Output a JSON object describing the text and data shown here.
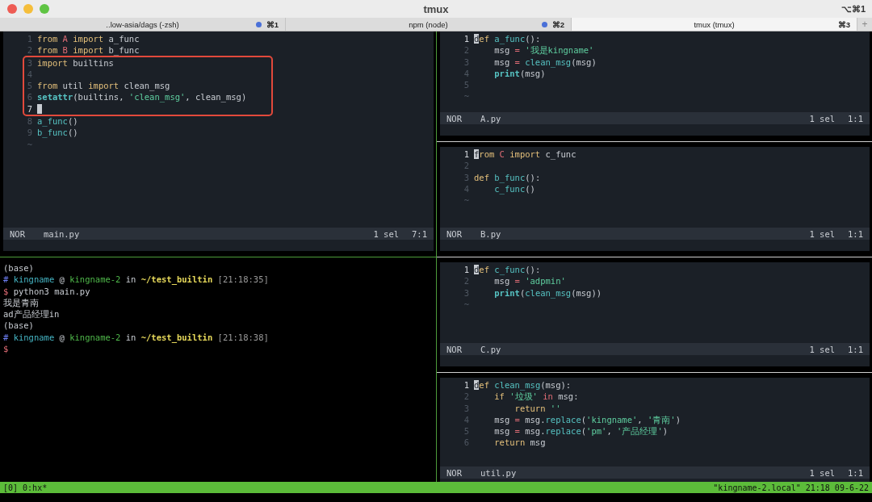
{
  "window": {
    "title": "tmux",
    "shortcut": "⌥⌘1"
  },
  "tabs": [
    {
      "label": "..low-asia/dags (-zsh)",
      "shortcut": "⌘1",
      "activity": true,
      "selected": false
    },
    {
      "label": "npm (node)",
      "shortcut": "⌘2",
      "activity": true,
      "selected": false
    },
    {
      "label": "tmux (tmux)",
      "shortcut": "⌘3",
      "activity": false,
      "selected": true
    }
  ],
  "new_tab": "+",
  "left_editor": {
    "lines": [
      {
        "number": "1",
        "cursor": false,
        "boxed": false,
        "tokens": [
          {
            "text": "from",
            "kind": "kw"
          },
          {
            "text": " A ",
            "kind": "mod"
          },
          {
            "text": "import",
            "kind": "kw"
          },
          {
            "text": " a_func",
            "kind": "plain"
          }
        ]
      },
      {
        "number": "2",
        "cursor": false,
        "boxed": false,
        "tokens": [
          {
            "text": "from",
            "kind": "kw"
          },
          {
            "text": " B ",
            "kind": "mod"
          },
          {
            "text": "import",
            "kind": "kw"
          },
          {
            "text": " b_func",
            "kind": "plain"
          }
        ]
      },
      {
        "number": "3",
        "cursor": false,
        "boxed": true,
        "tokens": [
          {
            "text": "import",
            "kind": "kw"
          },
          {
            "text": " builtins",
            "kind": "plain"
          }
        ]
      },
      {
        "number": "4",
        "cursor": false,
        "boxed": true
      },
      {
        "number": "5",
        "cursor": false,
        "boxed": true,
        "tokens": [
          {
            "text": "from",
            "kind": "kw"
          },
          {
            "text": " util ",
            "kind": "plain"
          },
          {
            "text": "import",
            "kind": "kw"
          },
          {
            "text": " clean_msg",
            "kind": "plain"
          }
        ]
      },
      {
        "number": "6",
        "cursor": false,
        "boxed": true,
        "tokens": [
          {
            "text": "setattr",
            "kind": "builtin"
          },
          {
            "text": "(builtins, ",
            "kind": "plain"
          },
          {
            "text": "'clean_msg'",
            "kind": "str"
          },
          {
            "text": ", clean_msg)",
            "kind": "plain"
          }
        ]
      },
      {
        "number": "7",
        "cursor": true,
        "boxed": true
      },
      {
        "number": "8",
        "cursor": false,
        "boxed": false,
        "tokens": [
          {
            "text": "a_func",
            "kind": "fn"
          },
          {
            "text": "()",
            "kind": "plain"
          }
        ]
      },
      {
        "number": "9",
        "cursor": false,
        "boxed": false,
        "tokens": [
          {
            "text": "b_func",
            "kind": "fn"
          },
          {
            "text": "()",
            "kind": "plain"
          }
        ]
      },
      {
        "number": "~",
        "cursor": false,
        "boxed": false
      }
    ],
    "status": {
      "mode": "NOR",
      "file": "main.py",
      "selection": "1 sel",
      "position": "7:1"
    }
  },
  "terminal": [
    [
      {
        "text": "(base)",
        "kind": "plain"
      }
    ],
    [
      {
        "text": "# ",
        "kind": "hash"
      },
      {
        "text": "kingname",
        "kind": "user"
      },
      {
        "text": " @ ",
        "kind": "plain"
      },
      {
        "text": "kingname-2",
        "kind": "host"
      },
      {
        "text": " in ",
        "kind": "plain"
      },
      {
        "text": "~/test_builtin",
        "kind": "path"
      },
      {
        "text": " [21:18:35]",
        "kind": "time"
      }
    ],
    [
      {
        "text": "$ ",
        "kind": "dollar"
      },
      {
        "text": "python3 main.py",
        "kind": "plain"
      }
    ],
    [
      {
        "text": "我是青南",
        "kind": "plain"
      }
    ],
    [
      {
        "text": "ad产品经理in",
        "kind": "plain"
      }
    ],
    [
      {
        "text": "(base)",
        "kind": "plain"
      }
    ],
    [
      {
        "text": "# ",
        "kind": "hash"
      },
      {
        "text": "kingname",
        "kind": "user"
      },
      {
        "text": " @ ",
        "kind": "plain"
      },
      {
        "text": "kingname-2",
        "kind": "host"
      },
      {
        "text": " in ",
        "kind": "plain"
      },
      {
        "text": "~/test_builtin",
        "kind": "path"
      },
      {
        "text": " [21:18:38]",
        "kind": "time"
      }
    ],
    [
      {
        "text": "$",
        "kind": "dollar"
      }
    ]
  ],
  "right_editors": [
    {
      "lines": [
        {
          "number": "1",
          "cursor": true,
          "boxed": false,
          "tokens": [
            {
              "text": "def",
              "kind": "kw"
            },
            {
              "text": " a_func",
              "kind": "fn"
            },
            {
              "text": "():",
              "kind": "plain"
            }
          ]
        },
        {
          "number": "2",
          "cursor": false,
          "boxed": false,
          "tokens": [
            {
              "text": "    msg ",
              "kind": "plain"
            },
            {
              "text": "=",
              "kind": "op"
            },
            {
              "text": " '我是kingname'",
              "kind": "str"
            }
          ]
        },
        {
          "number": "3",
          "cursor": false,
          "boxed": false,
          "tokens": [
            {
              "text": "    msg ",
              "kind": "plain"
            },
            {
              "text": "=",
              "kind": "op"
            },
            {
              "text": " clean_msg",
              "kind": "fn"
            },
            {
              "text": "(msg)",
              "kind": "plain"
            }
          ]
        },
        {
          "number": "4",
          "cursor": false,
          "boxed": false,
          "tokens": [
            {
              "text": "    print",
              "kind": "builtin"
            },
            {
              "text": "(msg)",
              "kind": "plain"
            }
          ]
        },
        {
          "number": "5",
          "cursor": false,
          "boxed": false
        },
        {
          "number": "~",
          "cursor": false,
          "boxed": false
        }
      ],
      "status": {
        "mode": "NOR",
        "file": "A.py",
        "selection": "1 sel",
        "position": "1:1"
      }
    },
    {
      "lines": [
        {
          "number": "1",
          "cursor": true,
          "boxed": false,
          "tokens": [
            {
              "text": "from",
              "kind": "kw"
            },
            {
              "text": " C ",
              "kind": "mod"
            },
            {
              "text": "import",
              "kind": "kw"
            },
            {
              "text": " c_func",
              "kind": "plain"
            }
          ]
        },
        {
          "number": "2",
          "cursor": false,
          "boxed": false
        },
        {
          "number": "3",
          "cursor": false,
          "boxed": false,
          "tokens": [
            {
              "text": "def",
              "kind": "kw"
            },
            {
              "text": " b_func",
              "kind": "fn"
            },
            {
              "text": "():",
              "kind": "plain"
            }
          ]
        },
        {
          "number": "4",
          "cursor": false,
          "boxed": false,
          "tokens": [
            {
              "text": "    c_func",
              "kind": "fn"
            },
            {
              "text": "()",
              "kind": "plain"
            }
          ]
        },
        {
          "number": "~",
          "cursor": false,
          "boxed": false
        }
      ],
      "status": {
        "mode": "NOR",
        "file": "B.py",
        "selection": "1 sel",
        "position": "1:1"
      }
    },
    {
      "lines": [
        {
          "number": "1",
          "cursor": true,
          "boxed": false,
          "tokens": [
            {
              "text": "def",
              "kind": "kw"
            },
            {
              "text": " c_func",
              "kind": "fn"
            },
            {
              "text": "():",
              "kind": "plain"
            }
          ]
        },
        {
          "number": "2",
          "cursor": false,
          "boxed": false,
          "tokens": [
            {
              "text": "    msg ",
              "kind": "plain"
            },
            {
              "text": "=",
              "kind": "op"
            },
            {
              "text": " 'adpmin'",
              "kind": "str"
            }
          ]
        },
        {
          "number": "3",
          "cursor": false,
          "boxed": false,
          "tokens": [
            {
              "text": "    print",
              "kind": "builtin"
            },
            {
              "text": "(",
              "kind": "plain"
            },
            {
              "text": "clean_msg",
              "kind": "fn"
            },
            {
              "text": "(msg))",
              "kind": "plain"
            }
          ]
        },
        {
          "number": "~",
          "cursor": false,
          "boxed": false
        }
      ],
      "status": {
        "mode": "NOR",
        "file": "C.py",
        "selection": "1 sel",
        "position": "1:1"
      }
    },
    {
      "lines": [
        {
          "number": "1",
          "cursor": true,
          "boxed": false,
          "tokens": [
            {
              "text": "def",
              "kind": "kw"
            },
            {
              "text": " clean_msg",
              "kind": "fn"
            },
            {
              "text": "(msg):",
              "kind": "plain"
            }
          ]
        },
        {
          "number": "2",
          "cursor": false,
          "boxed": false,
          "tokens": [
            {
              "text": "    if",
              "kind": "kw"
            },
            {
              "text": " '垃圾' ",
              "kind": "str"
            },
            {
              "text": "in",
              "kind": "op"
            },
            {
              "text": " msg:",
              "kind": "plain"
            }
          ]
        },
        {
          "number": "3",
          "cursor": false,
          "boxed": false,
          "tokens": [
            {
              "text": "        return",
              "kind": "kw"
            },
            {
              "text": " ''",
              "kind": "str"
            }
          ]
        },
        {
          "number": "4",
          "cursor": false,
          "boxed": false,
          "tokens": [
            {
              "text": "    msg ",
              "kind": "plain"
            },
            {
              "text": "=",
              "kind": "op"
            },
            {
              "text": " msg.",
              "kind": "plain"
            },
            {
              "text": "replace",
              "kind": "fn"
            },
            {
              "text": "(",
              "kind": "plain"
            },
            {
              "text": "'kingname'",
              "kind": "str"
            },
            {
              "text": ", ",
              "kind": "plain"
            },
            {
              "text": "'青南'",
              "kind": "str"
            },
            {
              "text": ")",
              "kind": "plain"
            }
          ]
        },
        {
          "number": "5",
          "cursor": false,
          "boxed": false,
          "tokens": [
            {
              "text": "    msg ",
              "kind": "plain"
            },
            {
              "text": "=",
              "kind": "op"
            },
            {
              "text": " msg.",
              "kind": "plain"
            },
            {
              "text": "replace",
              "kind": "fn"
            },
            {
              "text": "(",
              "kind": "plain"
            },
            {
              "text": "'pm'",
              "kind": "str"
            },
            {
              "text": ", ",
              "kind": "plain"
            },
            {
              "text": "'产品经理'",
              "kind": "str"
            },
            {
              "text": ")",
              "kind": "plain"
            }
          ]
        },
        {
          "number": "6",
          "cursor": false,
          "boxed": false,
          "tokens": [
            {
              "text": "    return",
              "kind": "kw"
            },
            {
              "text": " msg",
              "kind": "plain"
            }
          ]
        }
      ],
      "status": {
        "mode": "NOR",
        "file": "util.py",
        "selection": "1 sel",
        "position": "1:1"
      }
    }
  ],
  "tmux_status": {
    "left": "[0] 0:hx*",
    "right": "\"kingname-2.local\" 21:18 09-6-22"
  }
}
